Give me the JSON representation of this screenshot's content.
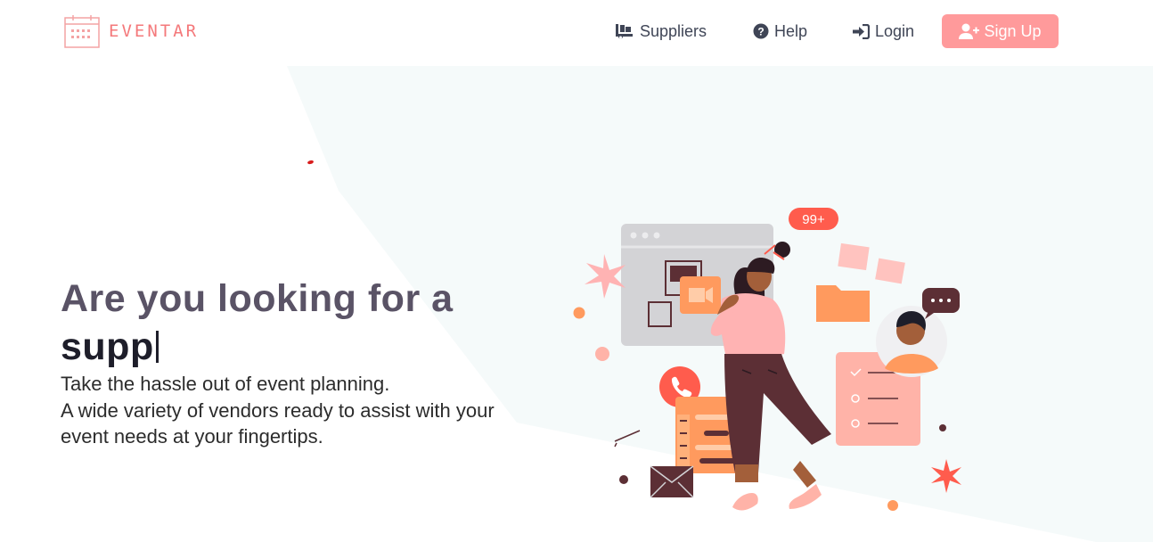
{
  "brand": {
    "name": "EVENTAR",
    "color": "#f4797b"
  },
  "nav": {
    "suppliers": {
      "label": "Suppliers",
      "icon": "truck-loading-icon"
    },
    "help": {
      "label": "Help",
      "icon": "question-circle-icon"
    },
    "login": {
      "label": "Login",
      "icon": "sign-in-icon"
    },
    "signup": {
      "label": "Sign Up",
      "icon": "user-plus-icon",
      "color": "#ff9a9b"
    }
  },
  "hero": {
    "title": "Are you looking for a",
    "typed_text": "supp",
    "line1": "Take the hassle out of event planning.",
    "line2": "A wide variety of vendors ready to assist with your",
    "line3": "event needs at your fingertips."
  },
  "illustration": {
    "notification_badge": "99+"
  },
  "colors": {
    "accent": "#ff9a9b",
    "panel": "#f5fafa",
    "heading": "#5a5366"
  }
}
